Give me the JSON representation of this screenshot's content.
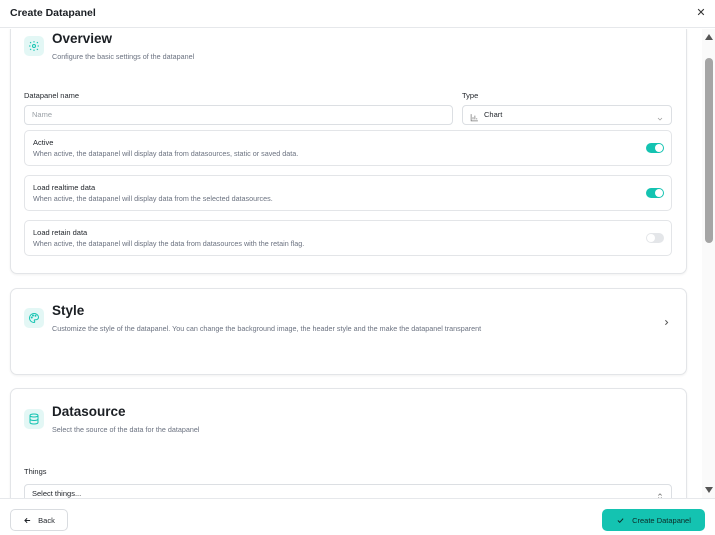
{
  "dialog": {
    "title": "Create Datapanel"
  },
  "overview": {
    "title": "Overview",
    "subtitle": "Configure the basic settings of the datapanel",
    "name_label": "Datapanel name",
    "name_placeholder": "Name",
    "type_label": "Type",
    "type_value": "Chart",
    "options": [
      {
        "title": "Active",
        "description": "When active, the datapanel will display data from datasources, static or saved data.",
        "enabled": true
      },
      {
        "title": "Load realtime data",
        "description": "When active, the datapanel will display data from the selected datasources.",
        "enabled": true
      },
      {
        "title": "Load retain data",
        "description": "When active, the datapanel will display the data from datasources with the retain flag.",
        "enabled": false
      }
    ]
  },
  "style": {
    "title": "Style",
    "subtitle": "Customize the style of the datapanel. You can change the background image, the header style and the make the datapanel transparent"
  },
  "datasource": {
    "title": "Datasource",
    "subtitle": "Select the source of the data for the datapanel",
    "things_label": "Things",
    "things_value": "Select things..."
  },
  "footer": {
    "back_label": "Back",
    "create_label": "Create Datapanel"
  },
  "colors": {
    "accent": "#14c3b1",
    "accent_bg": "#e3f7f5",
    "border": "#e3e5e8"
  },
  "icons": {
    "overview": "gear-icon",
    "style": "palette-icon",
    "datasource": "database-icon",
    "type": "bar-chart-icon",
    "back": "arrow-left-icon",
    "create": "check-icon"
  }
}
